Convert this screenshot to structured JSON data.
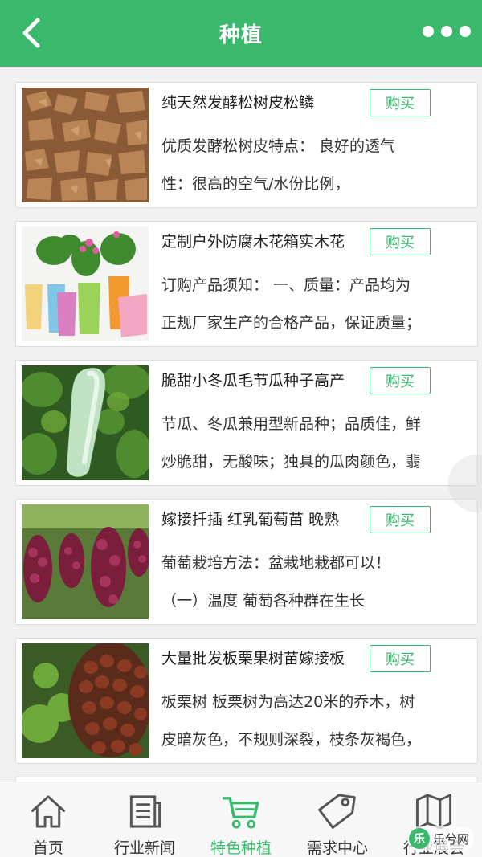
{
  "header": {
    "title": "种植"
  },
  "products": [
    {
      "name": "纯天然发酵松树皮松鳞",
      "buy_label": "购买",
      "desc_lines": [
        "优质发酵松树皮特点： 良好的透气",
        "性：很高的空气/水份比例，"
      ],
      "image": "pine-bark"
    },
    {
      "name": "定制户外防腐木花箱实木花",
      "buy_label": "购买",
      "desc_lines": [
        "订购产品须知： 一、质量：产品均为",
        "正规厂家生产的合格产品，保证质量；"
      ],
      "image": "flower-pots"
    },
    {
      "name": "脆甜小冬瓜毛节瓜种子高产",
      "buy_label": "购买",
      "desc_lines": [
        "节瓜、冬瓜兼用型新品种；品质佳，鲜",
        "炒脆甜，无酸味；独具的瓜肉颜色，翡"
      ],
      "image": "winter-melon"
    },
    {
      "name": "嫁接扦插 红乳葡萄苗 晚熟",
      "buy_label": "购买",
      "desc_lines": [
        "葡萄栽培方法：盆栽地栽都可以！",
        "（一）温度 葡萄各种群在生长"
      ],
      "image": "grapes"
    },
    {
      "name": "大量批发板栗果树苗嫁接板",
      "buy_label": "购买",
      "desc_lines": [
        "板栗树 板栗树为高达20米的乔木，树",
        "皮暗灰色，不规则深裂，枝条灰褐色，"
      ],
      "image": "chestnuts"
    }
  ],
  "tabbar": {
    "tabs": [
      {
        "label": "首页",
        "icon": "home-icon",
        "active": false
      },
      {
        "label": "行业新闻",
        "icon": "news-icon",
        "active": false
      },
      {
        "label": "特色种植",
        "icon": "cart-icon",
        "active": true
      },
      {
        "label": "需求中心",
        "icon": "tag-icon",
        "active": false
      },
      {
        "label": "行业展会",
        "icon": "map-icon",
        "active": false
      }
    ]
  },
  "watermark": {
    "text": "乐兮网",
    "logo_char": "乐"
  },
  "colors": {
    "brand": "#3ab86b",
    "background": "#f0f0f0"
  }
}
